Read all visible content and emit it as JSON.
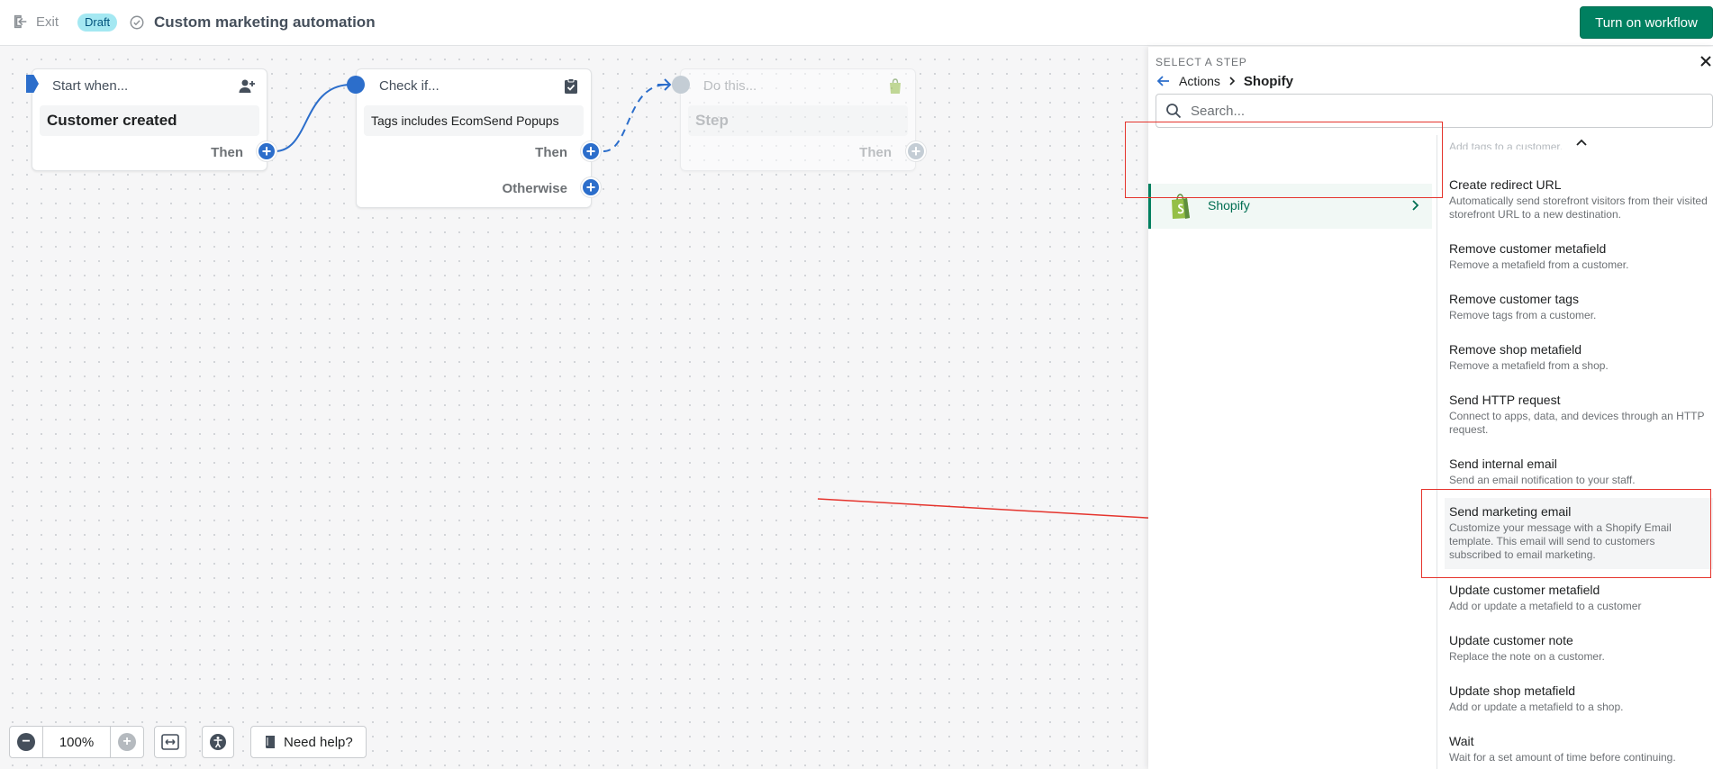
{
  "topbar": {
    "exit_label": "Exit",
    "status_badge": "Draft",
    "title": "Custom marketing automation",
    "turn_on_label": "Turn on workflow"
  },
  "canvas": {
    "trigger": {
      "header": "Start when...",
      "value": "Customer created",
      "then_label": "Then"
    },
    "condition": {
      "header": "Check if...",
      "value": "Tags includes EcomSend Popups",
      "then_label": "Then",
      "otherwise_label": "Otherwise"
    },
    "action": {
      "header": "Do this...",
      "value": "Step",
      "then_label": "Then"
    }
  },
  "controls": {
    "zoom_value": "100%",
    "help_label": "Need help?"
  },
  "panel": {
    "eyebrow": "SELECT A STEP",
    "breadcrumb_root": "Actions",
    "breadcrumb_current": "Shopify",
    "search_placeholder": "Search...",
    "category": {
      "label": "Shopify"
    },
    "cut_off_text": "Add tags to a customer.",
    "actions": [
      {
        "title": "Create redirect URL",
        "desc": "Automatically send storefront visitors from their visited storefront URL to a new destination."
      },
      {
        "title": "Remove customer metafield",
        "desc": "Remove a metafield from a customer."
      },
      {
        "title": "Remove customer tags",
        "desc": "Remove tags from a customer."
      },
      {
        "title": "Remove shop metafield",
        "desc": "Remove a metafield from a shop."
      },
      {
        "title": "Send HTTP request",
        "desc": "Connect to apps, data, and devices through an HTTP request."
      },
      {
        "title": "Send internal email",
        "desc": "Send an email notification to your staff."
      },
      {
        "title": "Send marketing email",
        "desc": "Customize your message with a Shopify Email template. This email will send to customers subscribed to email marketing."
      },
      {
        "title": "Update customer metafield",
        "desc": "Add or update a metafield to a customer"
      },
      {
        "title": "Update customer note",
        "desc": "Replace the note on a customer."
      },
      {
        "title": "Update shop metafield",
        "desc": "Add or update a metafield to a shop."
      },
      {
        "title": "Wait",
        "desc": "Wait for a set amount of time before continuing."
      }
    ]
  },
  "colors": {
    "accent_blue": "#2c6ecb",
    "primary_green": "#008060",
    "annotation_red": "#e5342d"
  }
}
